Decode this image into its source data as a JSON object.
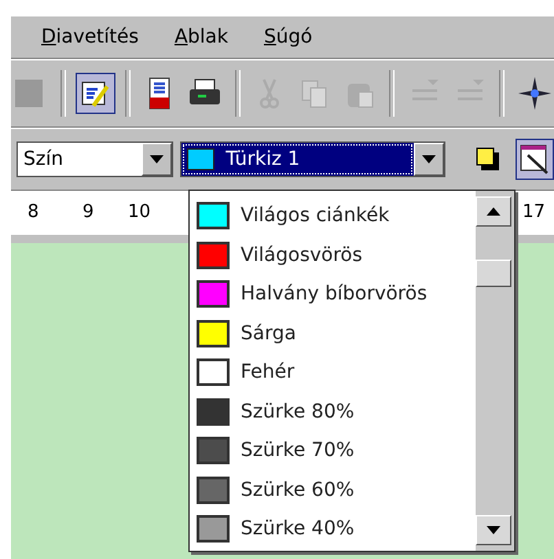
{
  "menu": [
    {
      "label": "Diavetítés"
    },
    {
      "label": "Ablak"
    },
    {
      "label": "Súgó"
    }
  ],
  "toolbar": [
    {
      "kind": "partial",
      "disabled": false,
      "pressed": false
    },
    {
      "kind": "sep"
    },
    {
      "kind": "edit",
      "disabled": false,
      "pressed": true
    },
    {
      "kind": "sep"
    },
    {
      "kind": "pdf",
      "disabled": false,
      "pressed": false
    },
    {
      "kind": "print",
      "disabled": false,
      "pressed": false
    },
    {
      "kind": "sep"
    },
    {
      "kind": "cut",
      "disabled": true,
      "pressed": false
    },
    {
      "kind": "copy",
      "disabled": true,
      "pressed": false
    },
    {
      "kind": "paste",
      "disabled": true,
      "pressed": false
    },
    {
      "kind": "sep"
    },
    {
      "kind": "undo",
      "disabled": true,
      "pressed": false
    },
    {
      "kind": "redo",
      "disabled": true,
      "pressed": false
    },
    {
      "kind": "sep"
    },
    {
      "kind": "navigator",
      "disabled": false,
      "pressed": false
    }
  ],
  "fill_type": {
    "value": "Szín"
  },
  "fill_color": {
    "value": "Türkiz 1",
    "color": "#00ccff"
  },
  "format_buttons": [
    {
      "kind": "shadow",
      "pressed": false
    },
    {
      "kind": "wand",
      "pressed": true
    }
  ],
  "ruler": [
    "8",
    "9",
    "10",
    "17"
  ],
  "color_list": {
    "items": [
      {
        "label": "Világos ciánkék",
        "color": "#00ffff"
      },
      {
        "label": "Világosvörös",
        "color": "#ff0000"
      },
      {
        "label": "Halvány bíborvörös",
        "color": "#ff00ff"
      },
      {
        "label": "Sárga",
        "color": "#ffff00"
      },
      {
        "label": "Fehér",
        "color": "#ffffff"
      },
      {
        "label": "Szürke 80%",
        "color": "#333333"
      },
      {
        "label": "Szürke 70%",
        "color": "#4c4c4c"
      },
      {
        "label": "Szürke 60%",
        "color": "#666666"
      },
      {
        "label": "Szürke 40%",
        "color": "#999999"
      }
    ]
  }
}
